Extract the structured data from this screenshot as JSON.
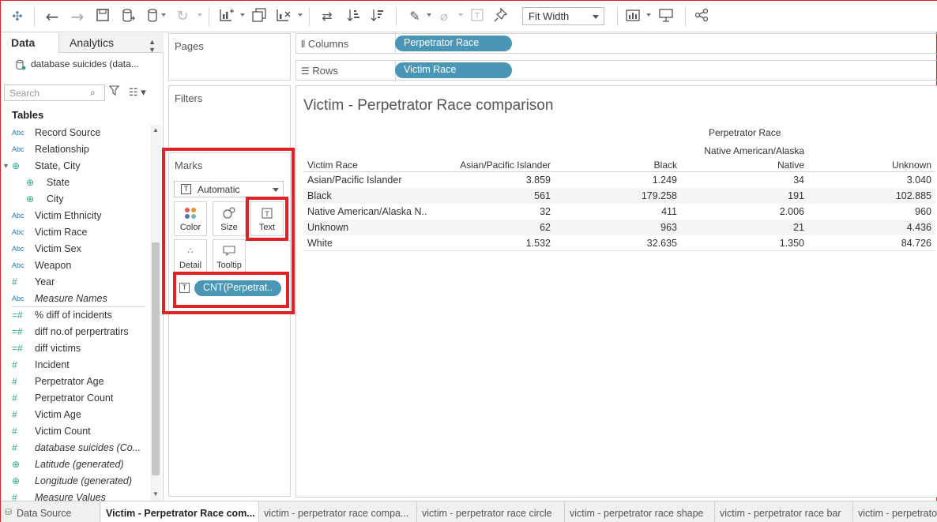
{
  "toolbar": {
    "fit_label": "Fit Width",
    "icons": [
      "tableau-logo-icon",
      "undo-icon",
      "redo-icon",
      "save-icon",
      "new-datasource-icon",
      "datasource-icon",
      "refresh-icon",
      "new-worksheet-icon",
      "duplicate-icon",
      "clear-icon",
      "swap-icon",
      "sort-asc-icon",
      "sort-desc-icon",
      "highlight-icon",
      "annotate-icon",
      "label-icon",
      "pin-icon",
      "show-me-icon",
      "presentation-icon",
      "share-icon"
    ]
  },
  "left_pane": {
    "tab_data": "Data",
    "tab_analytics": "Analytics",
    "datasource": "database suicides (data...",
    "search_placeholder": "Search",
    "tables_heading": "Tables",
    "fields": [
      {
        "type": "Abc",
        "name": "Record Source"
      },
      {
        "type": "Abc",
        "name": "Relationship"
      },
      {
        "type": "hier",
        "name": "State, City"
      },
      {
        "type": "geo",
        "name": "State"
      },
      {
        "type": "geo",
        "name": "City"
      },
      {
        "type": "Abc",
        "name": "Victim Ethnicity"
      },
      {
        "type": "Abc",
        "name": "Victim Race"
      },
      {
        "type": "Abc",
        "name": "Victim Sex"
      },
      {
        "type": "Abc",
        "name": "Weapon"
      },
      {
        "type": "#",
        "name": "Year"
      },
      {
        "type": "Abc",
        "name": "Measure Names"
      },
      {
        "type": "=#",
        "name": "% diff of incidents"
      },
      {
        "type": "=#",
        "name": "diff no.of perpertratirs"
      },
      {
        "type": "=#",
        "name": "diff victims"
      },
      {
        "type": "#",
        "name": "Incident"
      },
      {
        "type": "#",
        "name": "Perpetrator Age"
      },
      {
        "type": "#",
        "name": "Perpetrator Count"
      },
      {
        "type": "#",
        "name": "Victim Age"
      },
      {
        "type": "#",
        "name": "Victim Count"
      },
      {
        "type": "#",
        "name": "database suicides (Co..."
      },
      {
        "type": "geo",
        "name": "Latitude (generated)"
      },
      {
        "type": "geo",
        "name": "Longitude (generated)"
      },
      {
        "type": "#",
        "name": "Measure Values"
      }
    ]
  },
  "cards": {
    "pages": "Pages",
    "filters": "Filters",
    "marks": "Marks",
    "mark_type": "Automatic",
    "mark_buttons": {
      "color": "Color",
      "size": "Size",
      "text": "Text",
      "detail": "Detail",
      "tooltip": "Tooltip"
    },
    "text_pill": "CNT(Perpetrat.."
  },
  "shelves": {
    "columns_label": "Columns",
    "columns_pill": "Perpetrator Race",
    "rows_label": "Rows",
    "rows_pill": "Victim Race"
  },
  "viz": {
    "title": "Victim - Perpetrator Race comparison",
    "col_header": "Perpetrator Race",
    "row_header": "Victim Race",
    "columns": [
      "Asian/Pacific Islander",
      "Black",
      "Native American/Alaska",
      "Unknown"
    ],
    "native_second_line": "Native",
    "rows": [
      {
        "label": "Asian/Pacific Islander",
        "values": [
          "3.859",
          "1.249",
          "34",
          "3.040"
        ]
      },
      {
        "label": "Black",
        "values": [
          "561",
          "179.258",
          "191",
          "102.885"
        ]
      },
      {
        "label": "Native American/Alaska N..",
        "values": [
          "32",
          "411",
          "2.006",
          "960"
        ]
      },
      {
        "label": "Unknown",
        "values": [
          "62",
          "963",
          "21",
          "4.436"
        ]
      },
      {
        "label": "White",
        "values": [
          "1.532",
          "32.635",
          "1.350",
          "84.726"
        ]
      }
    ]
  },
  "bottom_tabs": {
    "data_source": "Data Source",
    "sheets": [
      "Victim - Perpetrator Race com...",
      "victim - perpetrator race compa...",
      "victim - perpetrator race circle",
      "victim - perpetrator race shape",
      "victim - perpetrator race bar",
      "victim - perpetrato"
    ]
  }
}
